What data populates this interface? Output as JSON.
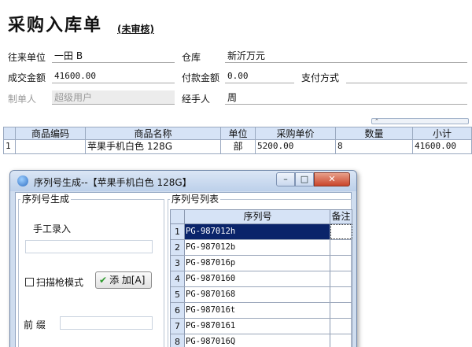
{
  "form": {
    "title": "采购入库单",
    "status": "(未审核)",
    "fields": {
      "partner_label": "往来单位",
      "partner_value": "一田 B",
      "warehouse_label": "仓库",
      "warehouse_value": "新沂万元",
      "amount_label": "成交金额",
      "amount_value": "41600.00",
      "paid_label": "付款金额",
      "paid_value": "0.00",
      "pay_method_label": "支付方式",
      "pay_method_value": "",
      "creator_label": "制单人",
      "creator_value": "超级用户",
      "handler_label": "经手人",
      "handler_value": "周"
    }
  },
  "grid": {
    "columns": [
      "商品编码",
      "商品名称",
      "单位",
      "采购单价",
      "数量",
      "小计"
    ],
    "rows": [
      {
        "index": "1",
        "code": "",
        "name": "苹果手机白色 128G",
        "unit": "部",
        "price": "5200.00",
        "qty": "8",
        "subtotal": "41600.00"
      }
    ],
    "splitter_glyph": "⌃"
  },
  "dialog": {
    "title": "序列号生成--【苹果手机白色 128G】",
    "window_buttons": {
      "min": "–",
      "max": "□",
      "close": "✕"
    },
    "gen_group_title": "序列号生成",
    "manual_entry_label": "手工录入",
    "scanner_mode_label": "扫描枪模式",
    "add_button_label": "添 加[A]",
    "prefix_label": "前 缀",
    "list_group_title": "序列号列表",
    "list_columns": [
      "序列号",
      "备注"
    ],
    "serials": [
      {
        "index": "1",
        "sn": "PG-987012h",
        "note": ""
      },
      {
        "index": "2",
        "sn": "PG-987012b",
        "note": ""
      },
      {
        "index": "3",
        "sn": "PG-987016p",
        "note": ""
      },
      {
        "index": "4",
        "sn": "PG-9870160",
        "note": ""
      },
      {
        "index": "5",
        "sn": "PG-9870168",
        "note": ""
      },
      {
        "index": "6",
        "sn": "PG-987016t",
        "note": ""
      },
      {
        "index": "7",
        "sn": "PG-9870161",
        "note": ""
      },
      {
        "index": "8",
        "sn": "PG-987016Q",
        "note": ""
      }
    ]
  }
}
